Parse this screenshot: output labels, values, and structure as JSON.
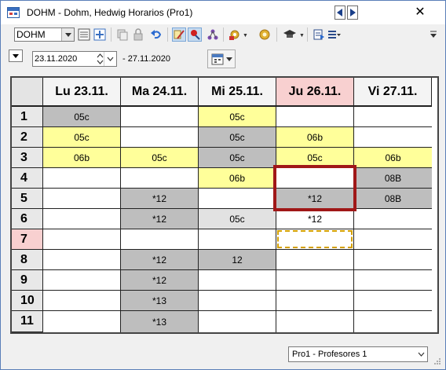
{
  "window": {
    "title": "DOHM - Dohm, Hedwig  Horarios  (Pro1)",
    "close_glyph": "✕"
  },
  "toolbar": {
    "element_combo_value": "DOHM",
    "icons": [
      "element-dropdown-arrow",
      "details-icon",
      "expand-icon",
      "copy-icon",
      "lock-icon",
      "undo-icon",
      "edit-icon",
      "search-pin-icon",
      "graph-icon",
      "gear-icon",
      "settings-gear-icon",
      "graduation-cap-icon",
      "export-icon",
      "list-format-icon"
    ]
  },
  "datebar": {
    "start_date": "23.11.2020",
    "end_date_text": "- 27.11.2020"
  },
  "timetable": {
    "days": [
      {
        "label": "Lu 23.11.",
        "today": false
      },
      {
        "label": "Ma 24.11.",
        "today": false
      },
      {
        "label": "Mi 25.11.",
        "today": false
      },
      {
        "label": "Ju 26.11.",
        "today": true
      },
      {
        "label": "Vi 27.11.",
        "today": false
      }
    ],
    "periods": [
      {
        "label": "1",
        "today": false
      },
      {
        "label": "2",
        "today": false
      },
      {
        "label": "3",
        "today": false
      },
      {
        "label": "4",
        "today": false
      },
      {
        "label": "5",
        "today": false
      },
      {
        "label": "6",
        "today": false
      },
      {
        "label": "7",
        "today": true
      },
      {
        "label": "8",
        "today": false
      },
      {
        "label": "9",
        "today": false
      },
      {
        "label": "10",
        "today": false
      },
      {
        "label": "11",
        "today": false
      }
    ],
    "cells": [
      [
        {
          "text": "05c",
          "color": "gray"
        },
        {
          "text": "",
          "color": "white"
        },
        {
          "text": "05c",
          "color": "yellow"
        },
        {
          "text": "",
          "color": "white"
        },
        {
          "text": "",
          "color": "white"
        }
      ],
      [
        {
          "text": "05c",
          "color": "yellow"
        },
        {
          "text": "",
          "color": "white"
        },
        {
          "text": "05c",
          "color": "gray"
        },
        {
          "text": "06b",
          "color": "yellow"
        },
        {
          "text": "",
          "color": "white"
        }
      ],
      [
        {
          "text": "06b",
          "color": "yellow"
        },
        {
          "text": "05c",
          "color": "yellow"
        },
        {
          "text": "05c",
          "color": "gray"
        },
        {
          "text": "05c",
          "color": "yellow"
        },
        {
          "text": "06b",
          "color": "yellow"
        }
      ],
      [
        {
          "text": "",
          "color": "white"
        },
        {
          "text": "",
          "color": "white"
        },
        {
          "text": "06b",
          "color": "yellow"
        },
        {
          "text": "",
          "color": "white"
        },
        {
          "text": "08B",
          "color": "gray"
        }
      ],
      [
        {
          "text": "",
          "color": "white"
        },
        {
          "text": "*12",
          "color": "gray"
        },
        {
          "text": "",
          "color": "white"
        },
        {
          "text": "*12",
          "color": "gray"
        },
        {
          "text": "08B",
          "color": "gray"
        }
      ],
      [
        {
          "text": "",
          "color": "white"
        },
        {
          "text": "*12",
          "color": "gray"
        },
        {
          "text": "05c",
          "color": "lightgray"
        },
        {
          "text": "*12",
          "color": "white"
        },
        {
          "text": "",
          "color": "white"
        }
      ],
      [
        {
          "text": "",
          "color": "white"
        },
        {
          "text": "",
          "color": "white"
        },
        {
          "text": "",
          "color": "white"
        },
        {
          "text": "",
          "color": "dashed"
        },
        {
          "text": "",
          "color": "white"
        }
      ],
      [
        {
          "text": "",
          "color": "white"
        },
        {
          "text": "*12",
          "color": "gray"
        },
        {
          "text": "12",
          "color": "gray"
        },
        {
          "text": "",
          "color": "white"
        },
        {
          "text": "",
          "color": "white"
        }
      ],
      [
        {
          "text": "",
          "color": "white"
        },
        {
          "text": "*12",
          "color": "gray"
        },
        {
          "text": "",
          "color": "white"
        },
        {
          "text": "",
          "color": "white"
        },
        {
          "text": "",
          "color": "white"
        }
      ],
      [
        {
          "text": "",
          "color": "white"
        },
        {
          "text": "*13",
          "color": "gray"
        },
        {
          "text": "",
          "color": "white"
        },
        {
          "text": "",
          "color": "white"
        },
        {
          "text": "",
          "color": "white"
        }
      ],
      [
        {
          "text": "",
          "color": "white"
        },
        {
          "text": "*13",
          "color": "gray"
        },
        {
          "text": "",
          "color": "white"
        },
        {
          "text": "",
          "color": "white"
        },
        {
          "text": "",
          "color": "white"
        }
      ]
    ]
  },
  "statusbar": {
    "format_combo_value": "Pro1 - Profesores 1"
  },
  "colors": {
    "gray": "#bebebe",
    "yellow": "#ffff9a",
    "lightgray": "#e2e2e2",
    "today_header": "#f8d0d0",
    "selection_border": "#a01818"
  }
}
